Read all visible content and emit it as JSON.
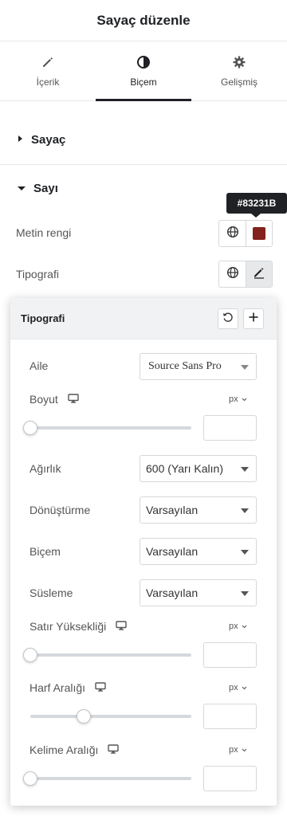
{
  "header": {
    "title": "Sayaç düzenle"
  },
  "tabs": [
    {
      "label": "İçerik",
      "icon": "pencil-icon",
      "active": false
    },
    {
      "label": "Biçem",
      "icon": "half-circle-icon",
      "active": true
    },
    {
      "label": "Gelişmiş",
      "icon": "gear-icon",
      "active": false
    }
  ],
  "sections": {
    "sayac": {
      "label": "Sayaç",
      "expanded": false
    },
    "sayi": {
      "label": "Sayı",
      "expanded": true
    }
  },
  "controls": {
    "text_color": {
      "label": "Metin rengi",
      "value": "#83231B",
      "tooltip": "#83231B"
    },
    "typography": {
      "label": "Tipografi"
    }
  },
  "popover": {
    "title": "Tipografi",
    "family": {
      "label": "Aile",
      "value": "Source Sans Pro"
    },
    "size": {
      "label": "Boyut",
      "unit": "px",
      "slider_fraction": 0.0
    },
    "weight": {
      "label": "Ağırlık",
      "value": "600 (Yarı Kalın)"
    },
    "transform": {
      "label": "Dönüştürme",
      "value": "Varsayılan"
    },
    "style": {
      "label": "Biçem",
      "value": "Varsayılan"
    },
    "decoration": {
      "label": "Süsleme",
      "value": "Varsayılan"
    },
    "line_height": {
      "label": "Satır Yüksekliği",
      "unit": "px",
      "slider_fraction": 0.0
    },
    "letter_spacing": {
      "label": "Harf Aralığı",
      "unit": "px",
      "slider_fraction": 0.33
    },
    "word_spacing": {
      "label": "Kelime Aralığı",
      "unit": "px",
      "slider_fraction": 0.0
    }
  },
  "colors": {
    "accent": "#1f2124",
    "swatch": "#83231B"
  }
}
